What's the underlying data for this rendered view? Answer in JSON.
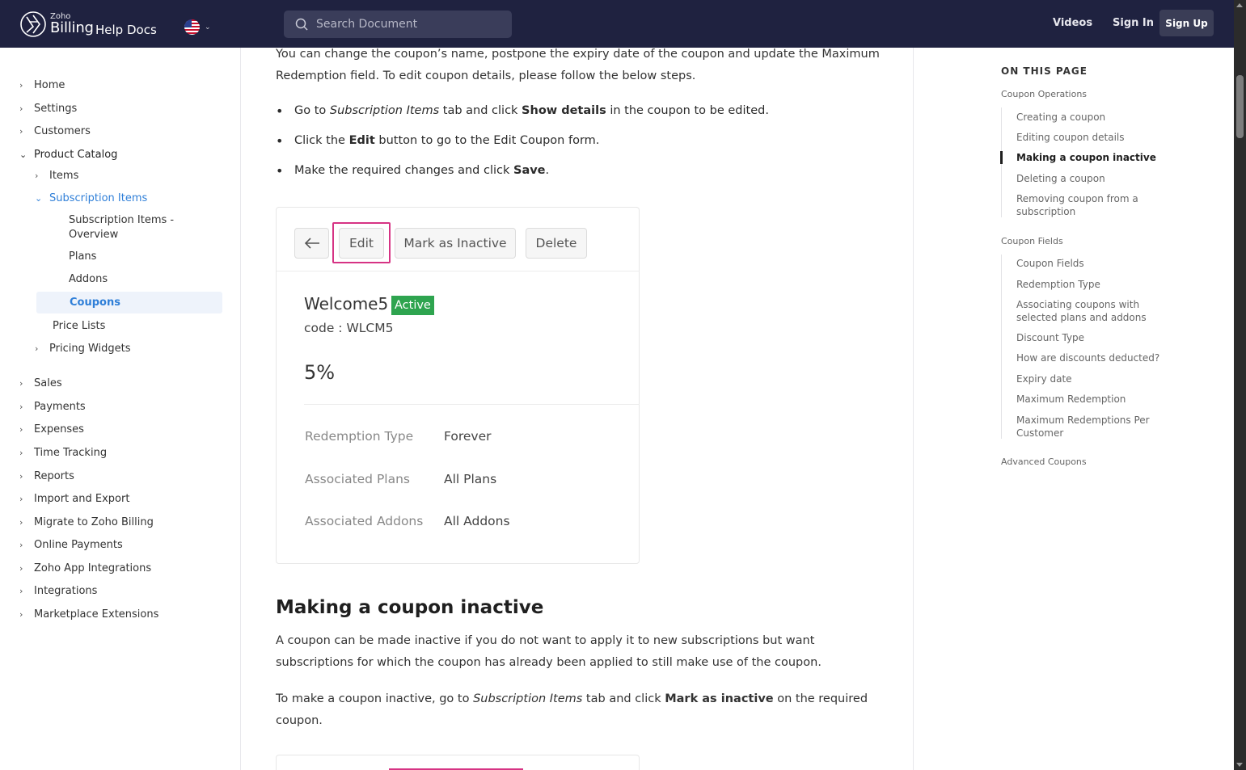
{
  "header": {
    "logo_zoho": "Zoho",
    "logo_billing": "Billing",
    "logo_helpdocs": "Help Docs",
    "search_placeholder": "Search Document",
    "videos": "Videos",
    "sign_in": "Sign In",
    "sign_up": "Sign Up"
  },
  "sidebar": {
    "home": "Home",
    "settings": "Settings",
    "customers": "Customers",
    "product_catalog": "Product Catalog",
    "items": "Items",
    "subscription_items": "Subscription Items",
    "subscription_items_overview": "Subscription Items - Overview",
    "plans": "Plans",
    "addons": "Addons",
    "coupons": "Coupons",
    "price_lists": "Price Lists",
    "pricing_widgets": "Pricing Widgets",
    "sales": "Sales",
    "payments": "Payments",
    "expenses": "Expenses",
    "time_tracking": "Time Tracking",
    "reports": "Reports",
    "import_export": "Import and Export",
    "migrate": "Migrate to Zoho Billing",
    "online_payments": "Online Payments",
    "zoho_app_integrations": "Zoho App Integrations",
    "integrations": "Integrations",
    "marketplace_extensions": "Marketplace Extensions"
  },
  "main": {
    "intro": "You can change the coupon’s name, postpone the expiry date of the coupon and update the Maximum Redemption field. To edit coupon details, please follow the below steps.",
    "bullet1_pre": "Go to ",
    "bullet1_em": "Subscription Items",
    "bullet1_mid": " tab and click ",
    "bullet1_strong": "Show details",
    "bullet1_post": " in the coupon to be edited.",
    "bullet2_pre": "Click the ",
    "bullet2_strong": "Edit",
    "bullet2_post": " button to go to the Edit Coupon form.",
    "bullet3_pre": "Make the required changes and click ",
    "bullet3_strong": "Save",
    "bullet3_post": ".",
    "card": {
      "edit": "Edit",
      "mark_inactive": "Mark as Inactive",
      "delete": "Delete",
      "coupon_name": "Welcome5",
      "status": "Active",
      "code": "code : WLCM5",
      "percent": "5%",
      "redemption_type_label": "Redemption Type",
      "redemption_type_value": "Forever",
      "plans_label": "Associated Plans",
      "plans_value": "All Plans",
      "addons_label": "Associated Addons",
      "addons_value": "All Addons"
    },
    "heading": "Making a coupon inactive",
    "para2": "A coupon can be made inactive if you do not want to apply it to new subscriptions but want subscriptions for which the coupon has already been applied to still make use of the coupon.",
    "para3_pre": "To make a coupon inactive, go to ",
    "para3_em": "Subscription Items",
    "para3_mid": " tab and click ",
    "para3_strong": "Mark as inactive",
    "para3_post": " on the required coupon."
  },
  "toc": {
    "title": "ON THIS PAGE",
    "section1": "Coupon Operations",
    "s1_items": [
      "Creating a coupon",
      "Editing coupon details",
      "Making a coupon inactive",
      "Deleting a coupon",
      "Removing coupon from a subscription"
    ],
    "section2": "Coupon Fields",
    "s2_items": [
      "Coupon Fields",
      "Redemption Type",
      "Associating coupons with selected plans and addons",
      "Discount Type",
      "How are discounts deducted?",
      "Expiry date",
      "Maximum Redemption",
      "Maximum Redemptions Per Customer"
    ],
    "section3": "Advanced Coupons"
  },
  "colors": {
    "header_bg": "#1f2240",
    "link_blue": "#2f7fd8",
    "highlight_pink": "#d63384",
    "badge_green": "#2ea44f"
  }
}
